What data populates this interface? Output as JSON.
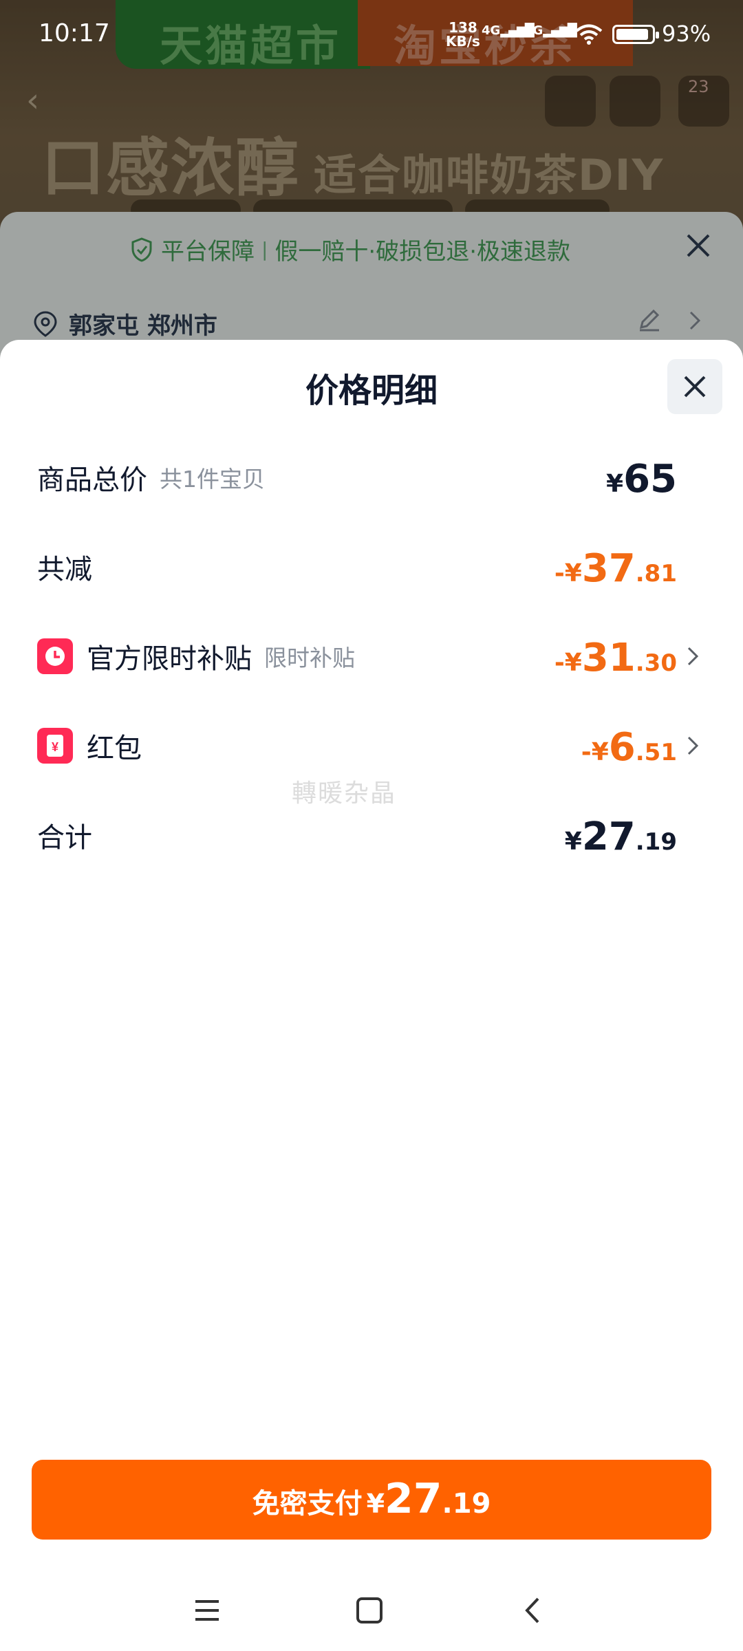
{
  "status_bar": {
    "time": "10:17",
    "net_speed_top": "138",
    "net_speed_bottom": "KB/s",
    "sig1": "4G",
    "sig2": "5G",
    "battery": "93%"
  },
  "background": {
    "banner_left": "天猫超市",
    "banner_right": "淘宝秒杀",
    "headline": "口感浓醇",
    "headline_small": "适合咖啡奶茶DIY",
    "cart_badge": "23"
  },
  "guarantee_sheet": {
    "title": "平台保障",
    "items": "假一赔十·破损包退·极速退款",
    "address": "郭家屯 郑州市"
  },
  "price_sheet": {
    "title": "价格明细",
    "rows": [
      {
        "label": "商品总价",
        "sub": "共1件宝贝",
        "prefix": "",
        "yen": "¥",
        "int": "65",
        "dec": ""
      },
      {
        "label": "共减",
        "sub": "",
        "prefix": "-",
        "yen": "¥",
        "int": "37",
        "dec": ".81"
      },
      {
        "label": "官方限时补贴",
        "sub": "限时补贴",
        "prefix": "-",
        "yen": "¥",
        "int": "31",
        "dec": ".30"
      },
      {
        "label": "红包",
        "sub": "",
        "prefix": "-",
        "yen": "¥",
        "int": "6",
        "dec": ".51"
      },
      {
        "label": "合计",
        "sub": "",
        "prefix": "",
        "yen": "¥",
        "int": "27",
        "dec": ".19"
      }
    ],
    "watermark": "轉暖杂晶",
    "pay_button": {
      "text": "免密支付",
      "yen": "¥",
      "int": "27",
      "dec": ".19"
    }
  },
  "colors": {
    "accent_orange": "#ff6200",
    "discount_orange": "#f26a13",
    "icon_red": "#ff2a55"
  }
}
